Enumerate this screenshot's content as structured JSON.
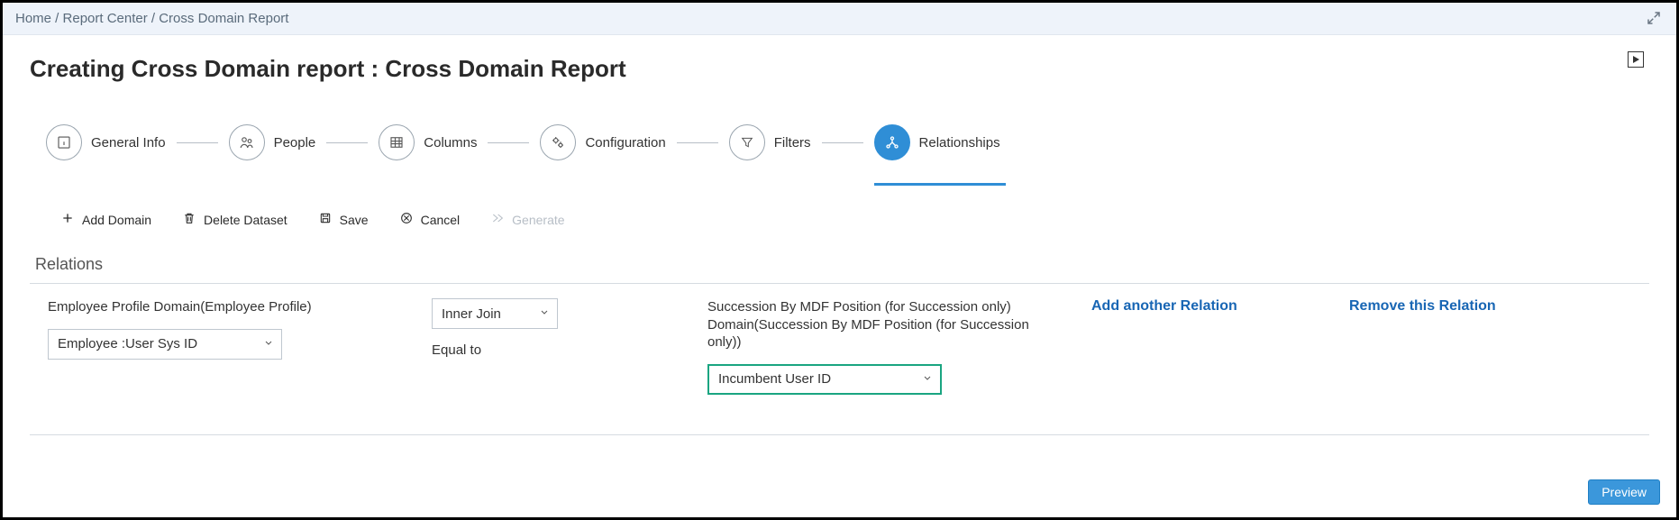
{
  "breadcrumb": {
    "items": [
      "Home",
      "Report Center",
      "Cross Domain Report"
    ],
    "text": "Home / Report Center / Cross Domain Report"
  },
  "page": {
    "title": "Creating Cross Domain report : Cross Domain Report"
  },
  "steps": [
    {
      "label": "General Info",
      "icon": "info-box",
      "active": false
    },
    {
      "label": "People",
      "icon": "people",
      "active": false
    },
    {
      "label": "Columns",
      "icon": "grid",
      "active": false
    },
    {
      "label": "Configuration",
      "icon": "gears",
      "active": false
    },
    {
      "label": "Filters",
      "icon": "funnel",
      "active": false
    },
    {
      "label": "Relationships",
      "icon": "network",
      "active": true
    }
  ],
  "toolbar": {
    "add_domain": "Add Domain",
    "delete_dataset": "Delete Dataset",
    "save": "Save",
    "cancel": "Cancel",
    "generate": "Generate"
  },
  "section": {
    "title": "Relations"
  },
  "relation": {
    "left_domain_label": "Employee Profile Domain(Employee Profile)",
    "left_field_value": "Employee :User Sys ID",
    "join_type_value": "Inner Join",
    "equal_to_label": "Equal to",
    "right_domain_label": "Succession By MDF Position (for Succession only) Domain(Succession By MDF Position (for Succession only))",
    "right_field_value": "Incumbent User ID",
    "add_link": "Add another Relation",
    "remove_link": "Remove this Relation"
  },
  "footer": {
    "preview": "Preview"
  }
}
